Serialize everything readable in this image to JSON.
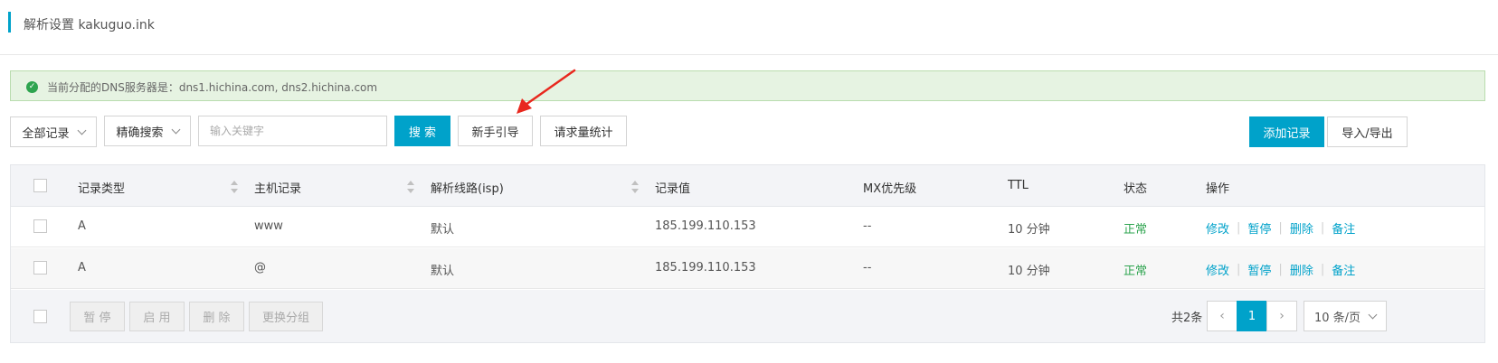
{
  "header": {
    "title": "解析设置 kakuguo.ink"
  },
  "notice": {
    "text": "当前分配的DNS服务器是：dns1.hichina.com, dns2.hichina.com",
    "icon": "check-circle-icon"
  },
  "toolbar": {
    "record_filter": "全部记录",
    "search_mode": "精确搜索",
    "keyword_placeholder": "输入关键字",
    "search_label": "搜 索",
    "guide_label": "新手引导",
    "stats_label": "请求量统计",
    "add_label": "添加记录",
    "import_export_label": "导入/导出"
  },
  "table": {
    "columns": [
      "记录类型",
      "主机记录",
      "解析线路(isp)",
      "记录值",
      "MX优先级",
      "TTL",
      "状态",
      "操作"
    ],
    "rows": [
      {
        "type": "A",
        "host": "www",
        "line": "默认",
        "value": "185.199.110.153",
        "mx": "--",
        "ttl": "10 分钟",
        "status": "正常"
      },
      {
        "type": "A",
        "host": "@",
        "line": "默认",
        "value": "185.199.110.153",
        "mx": "--",
        "ttl": "10 分钟",
        "status": "正常"
      }
    ],
    "actions": [
      "修改",
      "暂停",
      "删除",
      "备注"
    ]
  },
  "footer": {
    "batch_buttons": [
      "暂 停",
      "启 用",
      "删 除",
      "更换分组"
    ],
    "total": "共2条",
    "current_page": "1",
    "page_size": "10 条/页"
  },
  "colors": {
    "accent": "#00a2ca",
    "success": "#2ea44f",
    "notice_bg": "#e6f3e2",
    "annotation_arrow": "#e8281e"
  }
}
